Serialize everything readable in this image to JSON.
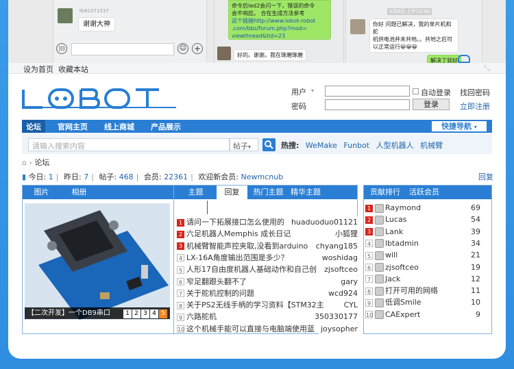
{
  "chats": {
    "left": {
      "username": "tb61071537",
      "message": "谢谢大神"
    },
    "middle": {
      "bubble_lines": [
        "命令后led2会闪一下，错误的命令",
        "会不响应。 合在生成方法参考",
        "这个链接http://www.lobot-robot",
        ".com/bbs/forum.php?mod=",
        "viewthread&tid=23"
      ],
      "reply": "好的。谢谢。我在琢磨琢磨"
    },
    "right": {
      "timestamp": "5月8日 上午10:40",
      "bubble_lines": [
        "你好 问题已解决，我的单片机和舵",
        "机供电池并未共地。。共地之后可",
        "以正常运行😀😀😀"
      ],
      "reply": "解决了就好"
    }
  },
  "topbar": {
    "set_home": "设为首页",
    "bookmark": "收藏本站"
  },
  "logo": {
    "text": "LOBOT"
  },
  "login": {
    "username_label": "用户",
    "password_label": "密码",
    "auto_login": "自动登录",
    "login_button": "登录",
    "find_password": "找回密码",
    "register": "立即注册"
  },
  "nav": {
    "items": [
      "论坛",
      "官网主页",
      "线上商城",
      "产品展示"
    ],
    "quick_nav": "快捷导航"
  },
  "search": {
    "placeholder": "请输入搜索内容",
    "scope": "帖子",
    "hot_label": "热搜:",
    "hot_terms": [
      "WeMake",
      "Funbot",
      "人型机器人",
      "机械臂"
    ]
  },
  "breadcrumb": {
    "current": "论坛"
  },
  "stats": {
    "today_label": "今日:",
    "today": "1",
    "yesterday_label": "昨日:",
    "yesterday": "7",
    "posts_label": "帖子:",
    "posts": "468",
    "members_label": "会员:",
    "members": "22361",
    "welcome_label": "欢迎新会员:",
    "newest_member": "Newmcnub",
    "reply_link": "回复"
  },
  "panel_left": {
    "tabs": [
      "图片",
      "相册"
    ],
    "caption": "【二次开发】一个DB9串口",
    "pages": [
      "1",
      "2",
      "3",
      "4",
      "5"
    ],
    "current_page": "5"
  },
  "panel_mid": {
    "tabs": [
      "主题",
      "回复",
      "热门主题",
      "精华主题"
    ],
    "topics": [
      {
        "n": "1",
        "title": "请问一下拓展接口怎么使用的",
        "author": "huaduoduo01121"
      },
      {
        "n": "2",
        "title": "六足机器人Memphis 成长日记",
        "author": "小狐狸"
      },
      {
        "n": "3",
        "title": "机械臂智能声控夹取,没看到arduino",
        "author": "chyang185"
      },
      {
        "n": "4",
        "title": "LX-16A角度输出范围是多少？",
        "author": "woshidag"
      },
      {
        "n": "5",
        "title": "人形17自由度机器人基础动作和自己创",
        "author": "zjsoftceo"
      },
      {
        "n": "6",
        "title": "窄足翻跟头翻不了",
        "author": "gary"
      },
      {
        "n": "7",
        "title": "关于舵机控制的问题",
        "author": "wcd924"
      },
      {
        "n": "8",
        "title": "关于PS2无线手柄的学习资料【STM32主",
        "author": "CYL"
      },
      {
        "n": "9",
        "title": "六路舵机",
        "author": "350330177"
      },
      {
        "n": "10",
        "title": "这个机械手能可以直接与电脑端使用蓝",
        "author": "joysopher"
      }
    ]
  },
  "panel_right": {
    "tabs": [
      "贡献排行",
      "活跃会员"
    ],
    "ranks": [
      {
        "n": "1",
        "name": "Raymond",
        "score": "69"
      },
      {
        "n": "2",
        "name": "Lucas",
        "score": "54"
      },
      {
        "n": "3",
        "name": "Lank",
        "score": "39"
      },
      {
        "n": "4",
        "name": "lbtadmin",
        "score": "34"
      },
      {
        "n": "5",
        "name": "will",
        "score": "21"
      },
      {
        "n": "6",
        "name": "zjsoftceo",
        "score": "19"
      },
      {
        "n": "7",
        "name": "Jack",
        "score": "12"
      },
      {
        "n": "8",
        "name": "打开可用的网络",
        "score": "11"
      },
      {
        "n": "9",
        "name": "低调Smile",
        "score": "10"
      },
      {
        "n": "10",
        "name": "CAExpert",
        "score": "9"
      }
    ]
  },
  "colors": {
    "brand_blue": "#2a7ed4",
    "rank_red": "#d9251c",
    "page_orange": "#f5841f"
  }
}
